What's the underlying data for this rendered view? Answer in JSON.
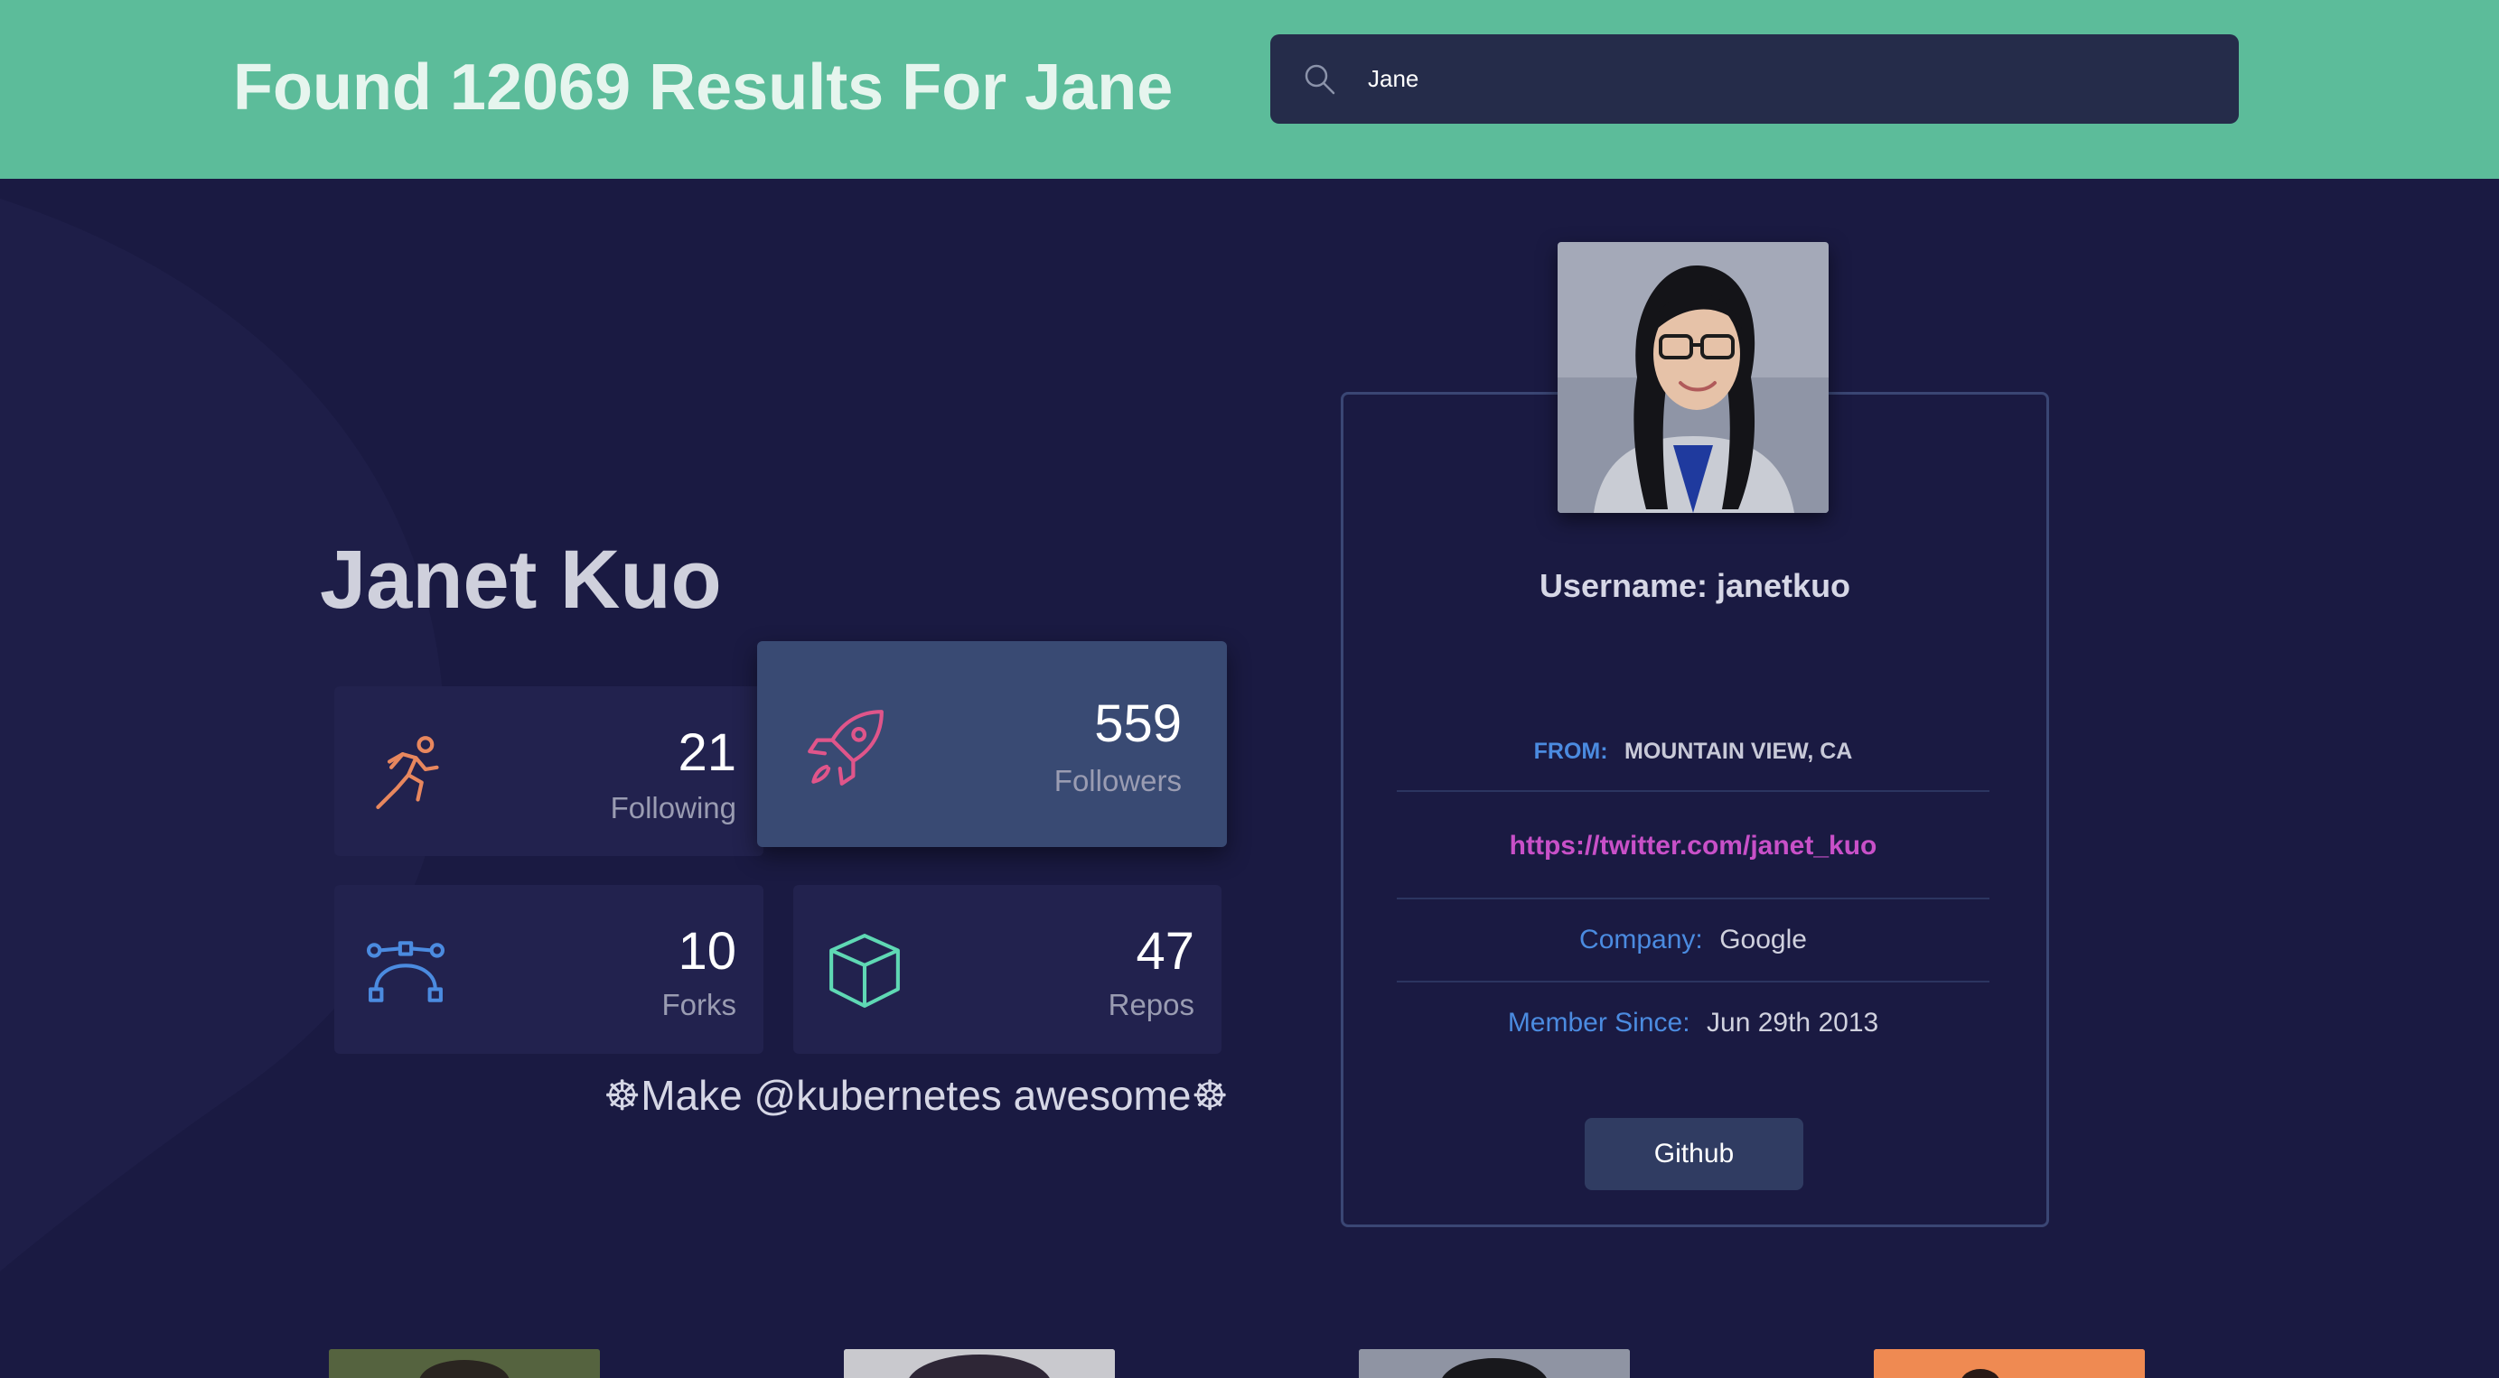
{
  "header": {
    "results_title": "Found 12069 Results For Jane",
    "search": {
      "value": "Jane",
      "icon": "search-icon"
    },
    "background_color": "#5cbc9a"
  },
  "profile": {
    "name": "Janet Kuo",
    "bio": "☸Make @kubernetes awesome☸",
    "stats": [
      {
        "value": "21",
        "label": "Following",
        "icon": "runner-icon",
        "color": "#e8875e"
      },
      {
        "value": "559",
        "label": "Followers",
        "icon": "rocket-icon",
        "color": "#e0558a"
      },
      {
        "value": "10",
        "label": "Forks",
        "icon": "bezier-curve-icon",
        "color": "#4b8be0"
      },
      {
        "value": "47",
        "label": "Repos",
        "icon": "box-icon",
        "color": "#5fd8b4"
      }
    ],
    "card": {
      "username": "Username: janetkuo",
      "from_label": "FROM:",
      "from_value": "MOUNTAIN VIEW, CA",
      "twitter_url": "https://twitter.com/janet_kuo",
      "company_label": "Company:",
      "company_value": "Google",
      "member_since_label": "Member Since:",
      "member_since_value": "Jun 29th 2013",
      "github_button": "Github"
    }
  },
  "colors": {
    "page_background": "#1a1a42",
    "accent_blue": "#4b8be0",
    "link_magenta": "#c850c8"
  }
}
